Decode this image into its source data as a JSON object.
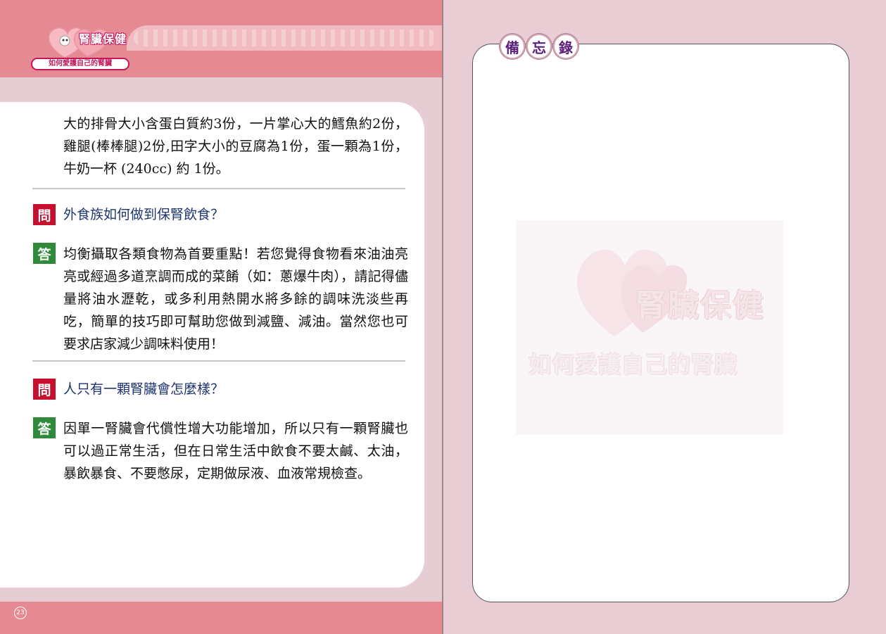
{
  "header": {
    "logo_title": "腎臟保健",
    "logo_subtitle": "如何愛護自己的腎臟"
  },
  "intro_text": "大的排骨大小含蛋白質約3份，一片掌心大的鱈魚約2份，雞腿(棒棒腿)2份,田字大小的豆腐為1份，蛋一顆為1份，牛奶一杯 (240cc)  約 1份。",
  "qa": [
    {
      "q_badge": "問",
      "question": "外食族如何做到保腎飲食？",
      "a_badge": "答",
      "answer": "均衡攝取各類食物為首要重點！若您覺得食物看來油油亮亮或經過多道烹調而成的菜餚（如：蔥爆牛肉），請記得儘量將油水瀝乾，或多利用熱開水將多餘的調味洗淡些再吃，簡單的技巧即可幫助您做到減鹽、減油。當然您也可要求店家減少調味料使用！"
    },
    {
      "q_badge": "問",
      "question": "人只有一顆腎臟會怎麼樣？",
      "a_badge": "答",
      "answer": "因單一腎臟會代償性增大功能增加，所以只有一顆腎臟也可以過正常生活，但在日常生活中飲食不要太鹹、太油，暴飲暴食、不要憋尿，定期做尿液、血液常規檢查。"
    }
  ],
  "page_number": "23",
  "memo": {
    "title_chars": [
      "備",
      "忘",
      "錄"
    ]
  },
  "watermark": {
    "title": "腎臟保健",
    "subtitle": "如何愛護自己的腎臟"
  },
  "colors": {
    "band_pink": "#e58a92",
    "page_bg": "#e8cdd4",
    "question_badge": "#c8102e",
    "answer_badge": "#2e8b3a",
    "question_text": "#1f3570",
    "memo_purple": "#5a1f7a"
  }
}
